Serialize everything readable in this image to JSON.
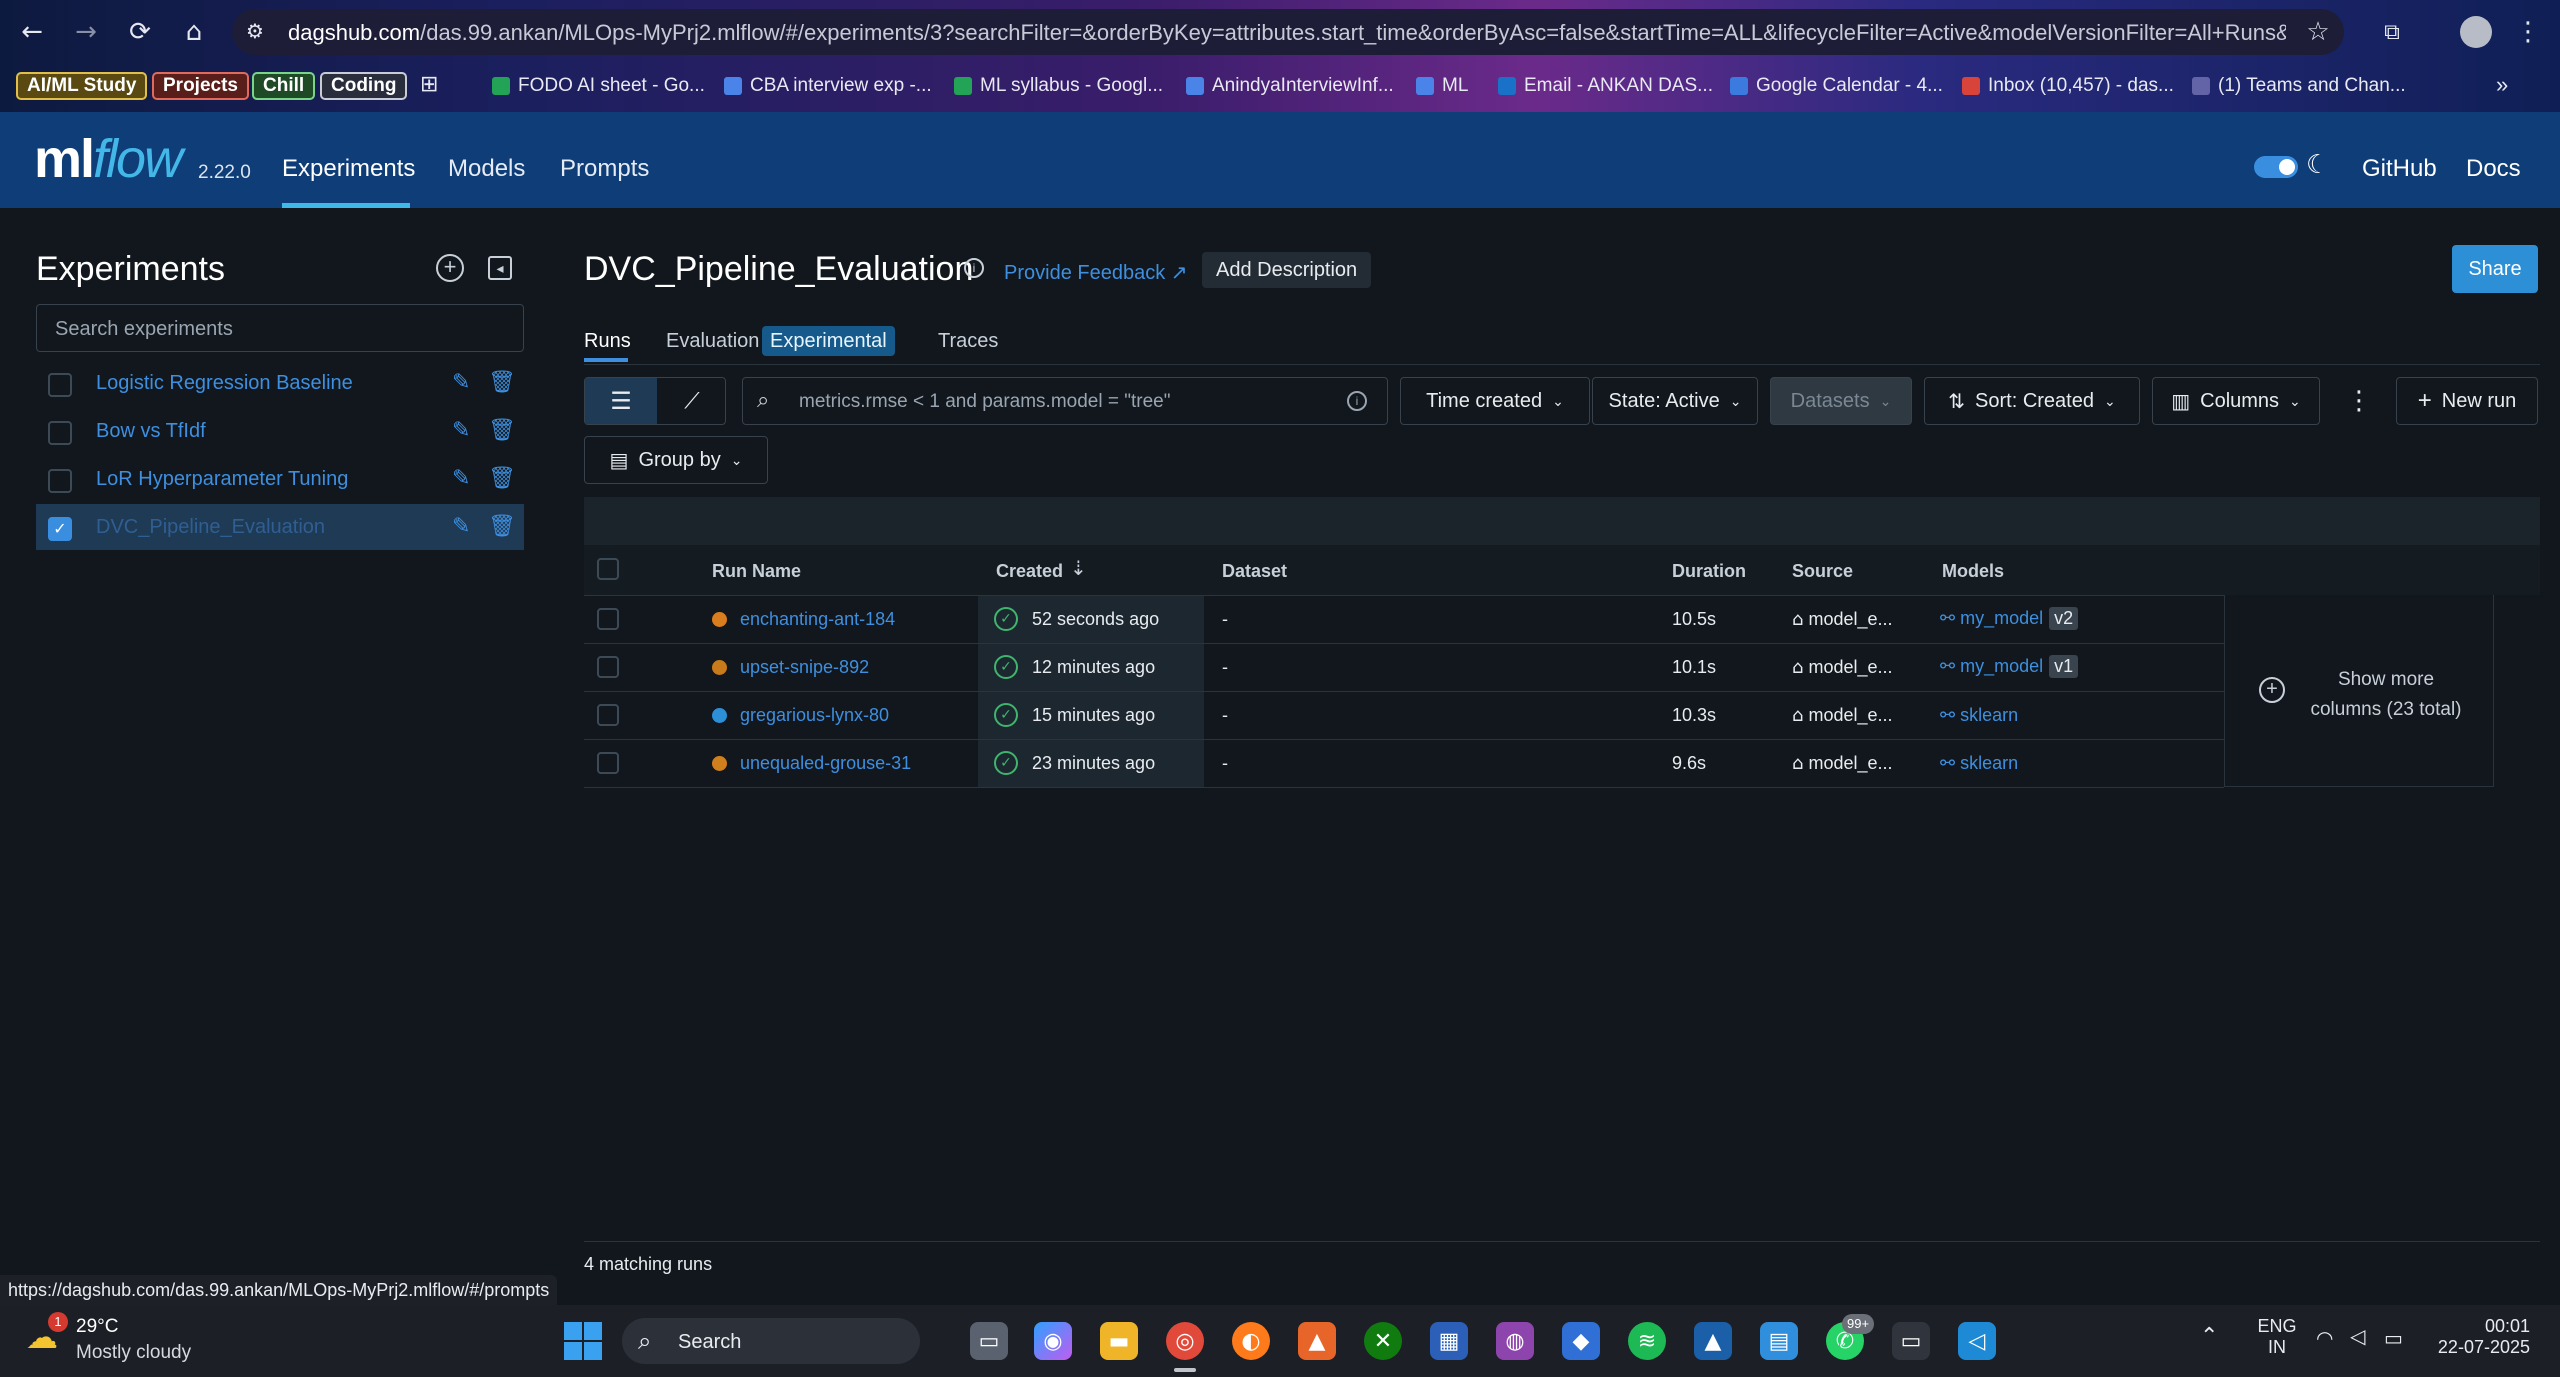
{
  "browser": {
    "url_host": "dagshub.com",
    "url_path": "/das.99.ankan/MLOps-MyPrj2.mlflow/#/experiments/3?searchFilter=&orderByKey=attributes.start_time&orderByAsc=false&startTime=ALL&lifecycleFilter=Active&modelVersionFilter=All+Runs&datase...",
    "bookmarks_groups": [
      "AI/ML Study",
      "Projects",
      "Chill",
      "Coding"
    ],
    "bookmarks": [
      "FODO AI sheet - Go...",
      "CBA interview exp -...",
      "ML syllabus - Googl...",
      "AnindyaInterviewInf...",
      "ML",
      "Email - ANKAN DAS...",
      "Google Calendar - 4...",
      "Inbox (10,457) - das...",
      "(1) Teams and Chan..."
    ],
    "status_url": "https://dagshub.com/das.99.ankan/MLOps-MyPrj2.mlflow/#/prompts"
  },
  "header": {
    "logo_ml": "ml",
    "logo_flow": "flow",
    "version": "2.22.0",
    "nav": [
      "Experiments",
      "Models",
      "Prompts"
    ],
    "github": "GitHub",
    "docs": "Docs"
  },
  "sidebar": {
    "title": "Experiments",
    "search_placeholder": "Search experiments",
    "items": [
      {
        "label": "Logistic Regression Baseline",
        "checked": false
      },
      {
        "label": "Bow vs TfIdf",
        "checked": false
      },
      {
        "label": "LoR Hyperparameter Tuning",
        "checked": false
      },
      {
        "label": "DVC_Pipeline_Evaluation",
        "checked": true
      }
    ]
  },
  "main": {
    "title": "DVC_Pipeline_Evaluation",
    "feedback": "Provide Feedback",
    "add_description": "Add Description",
    "share": "Share",
    "tabs": [
      "Runs",
      "Evaluation",
      "Traces"
    ],
    "experimental_badge": "Experimental",
    "search_placeholder": "metrics.rmse < 1 and params.model = \"tree\"",
    "time_created": "Time created",
    "state": "State: Active",
    "datasets": "Datasets",
    "sort": "Sort: Created",
    "columns": "Columns",
    "new_run": "New run",
    "group_by": "Group by",
    "table_headers": [
      "Run Name",
      "Created",
      "Dataset",
      "Duration",
      "Source",
      "Models"
    ],
    "runs": [
      {
        "name": "enchanting-ant-184",
        "created": "52 seconds ago",
        "dataset": "-",
        "duration": "10.5s",
        "source": "model_e...",
        "model": "my_model",
        "version": "v2",
        "color": "#d97e1f"
      },
      {
        "name": "upset-snipe-892",
        "created": "12 minutes ago",
        "dataset": "-",
        "duration": "10.1s",
        "source": "model_e...",
        "model": "my_model",
        "version": "v1",
        "color": "#c97a1a"
      },
      {
        "name": "gregarious-lynx-80",
        "created": "15 minutes ago",
        "dataset": "-",
        "duration": "10.3s",
        "source": "model_e...",
        "model": "sklearn",
        "version": "",
        "color": "#2d8fd6"
      },
      {
        "name": "unequaled-grouse-31",
        "created": "23 minutes ago",
        "dataset": "-",
        "duration": "9.6s",
        "source": "model_e...",
        "model": "sklearn",
        "version": "",
        "color": "#d07f1e"
      }
    ],
    "show_more_line1": "Show more",
    "show_more_line2": "columns (23 total)",
    "matching_runs": "4 matching runs"
  },
  "taskbar": {
    "temp": "29°C",
    "weather": "Mostly cloudy",
    "weather_badge": "1",
    "search": "Search",
    "lang1": "ENG",
    "lang2": "IN",
    "time": "00:01",
    "date": "22-07-2025",
    "whatsapp_badge": "99+"
  }
}
